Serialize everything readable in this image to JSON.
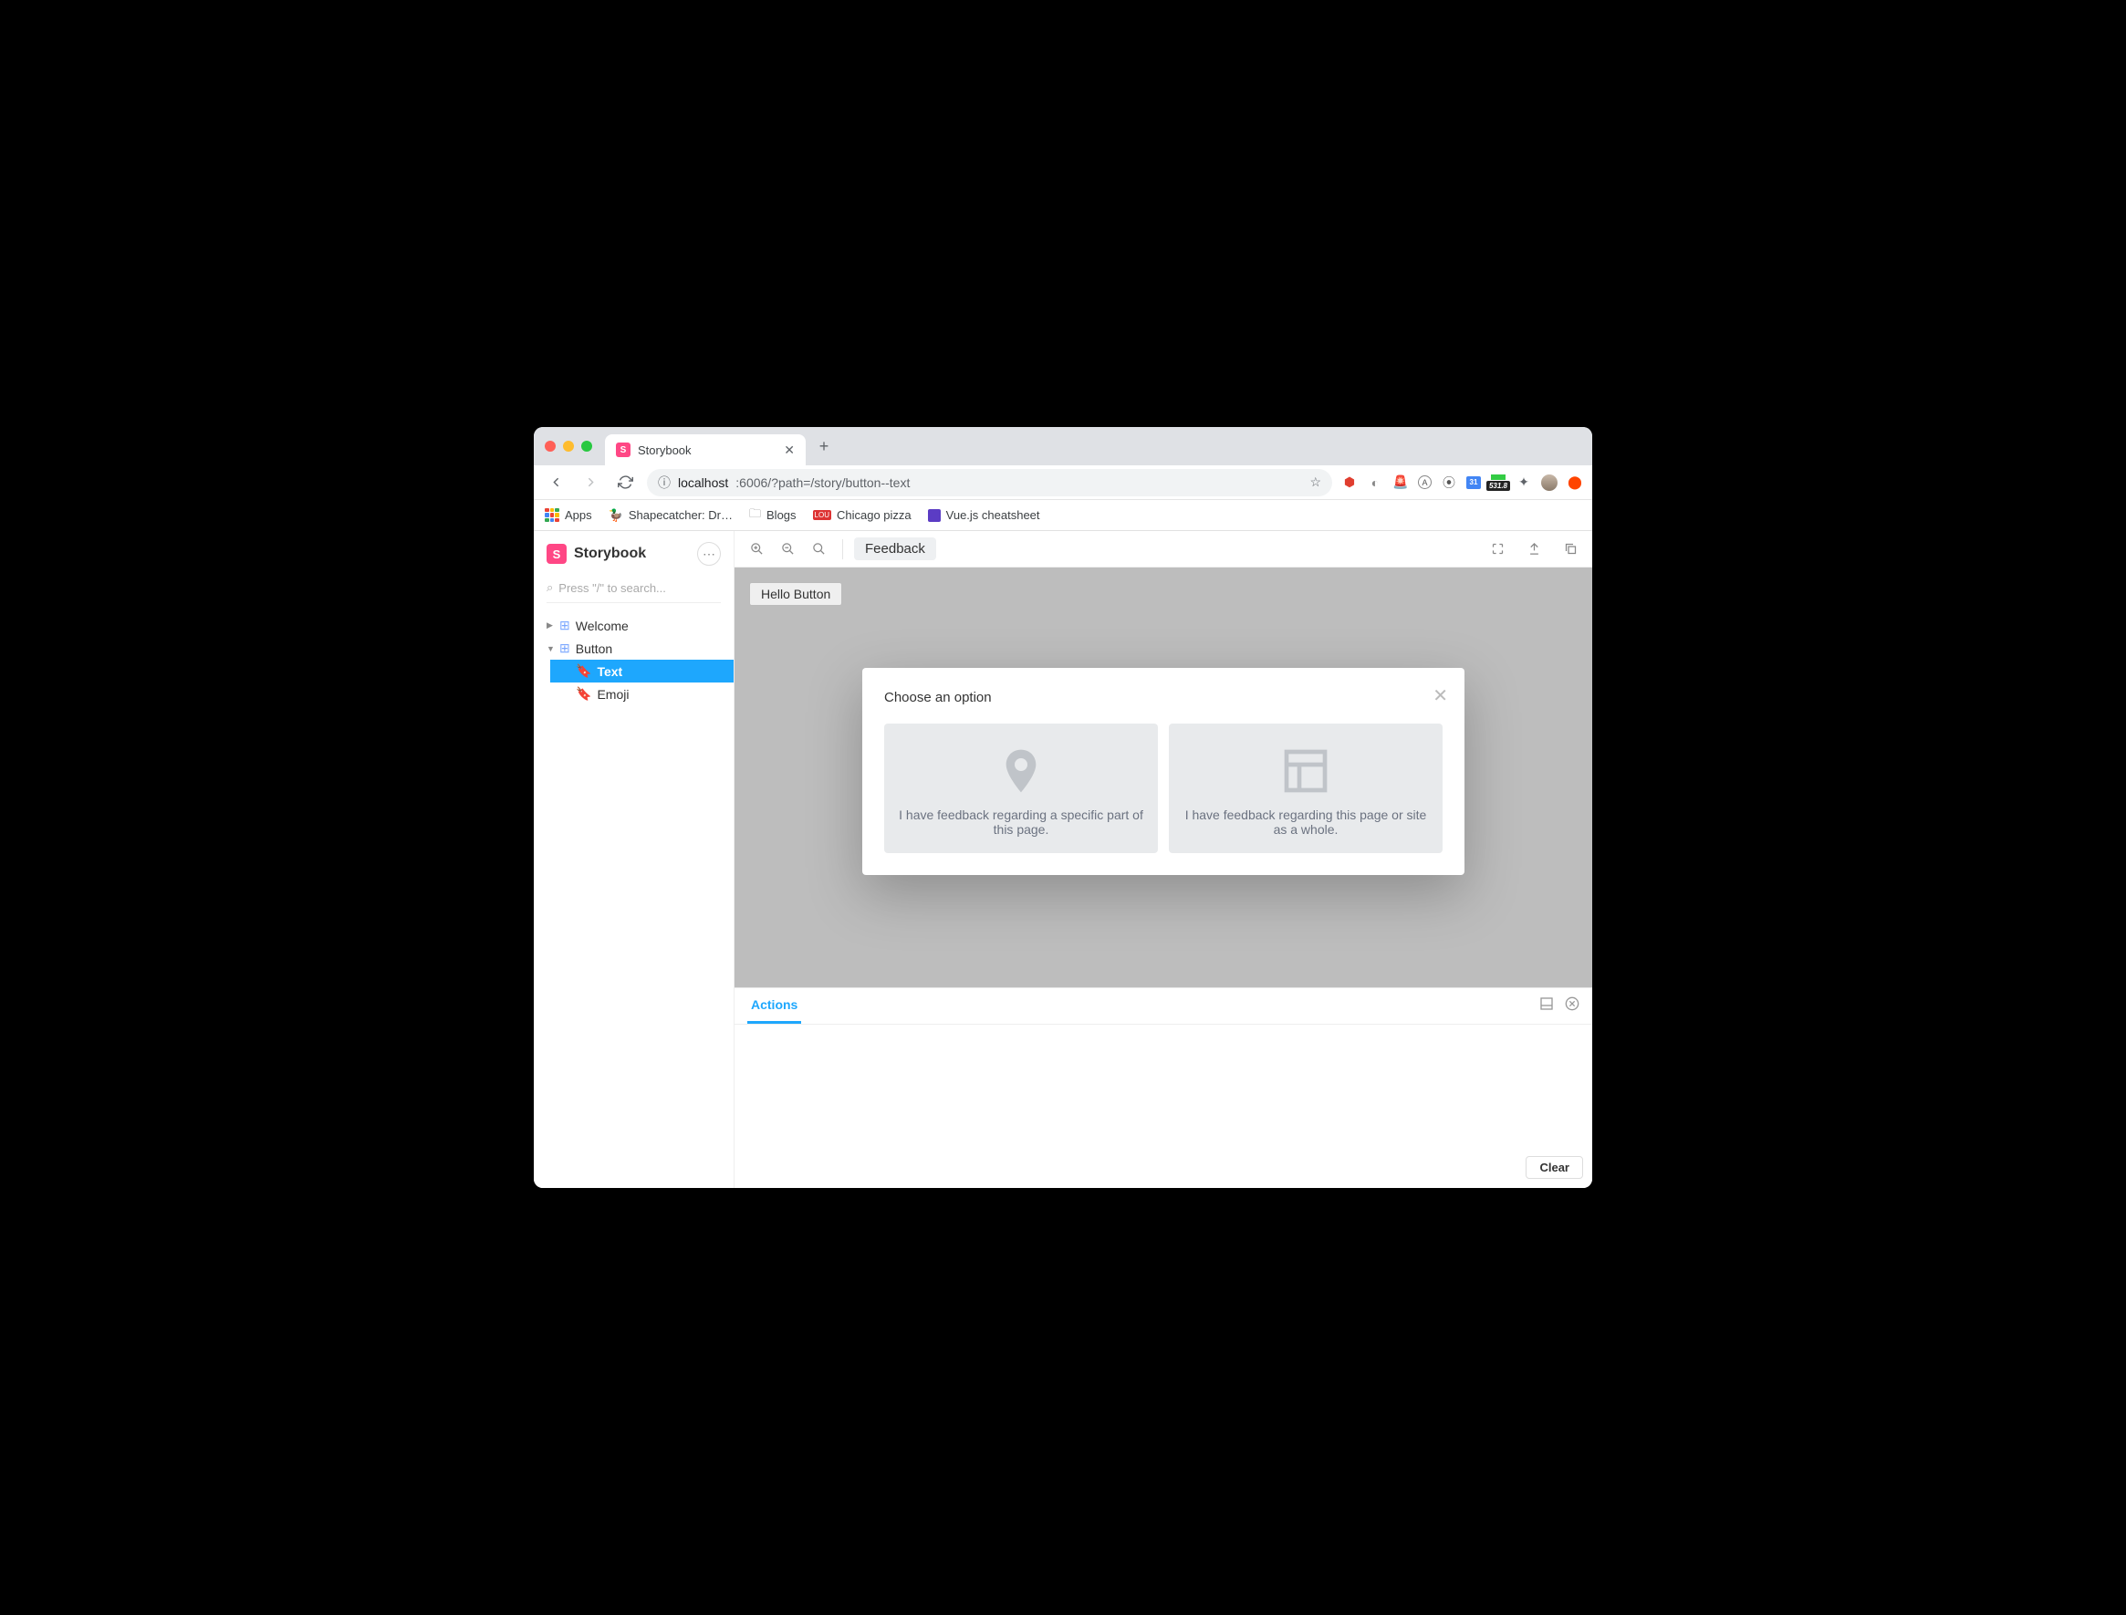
{
  "browser": {
    "tab_title": "Storybook",
    "url_host": "localhost",
    "url_port_path": ":6006/?path=/story/button--text",
    "bookmarks": {
      "apps": "Apps",
      "items": [
        "Shapecatcher: Dr…",
        "Blogs",
        "Chicago pizza",
        "Vue.js cheatsheet"
      ]
    },
    "ext_badge": "531.8"
  },
  "sidebar": {
    "brand": "Storybook",
    "search_placeholder": "Press \"/\" to search...",
    "tree": {
      "welcome": "Welcome",
      "button": "Button",
      "text": "Text",
      "emoji": "Emoji"
    }
  },
  "toolbar": {
    "chip": "Feedback"
  },
  "canvas": {
    "hello_button": "Hello Button",
    "modal": {
      "title": "Choose an option",
      "opt1": "I have feedback regarding a specific part of this page.",
      "opt2": "I have feedback regarding this page or site as a whole."
    }
  },
  "panel": {
    "tab": "Actions",
    "clear": "Clear"
  }
}
